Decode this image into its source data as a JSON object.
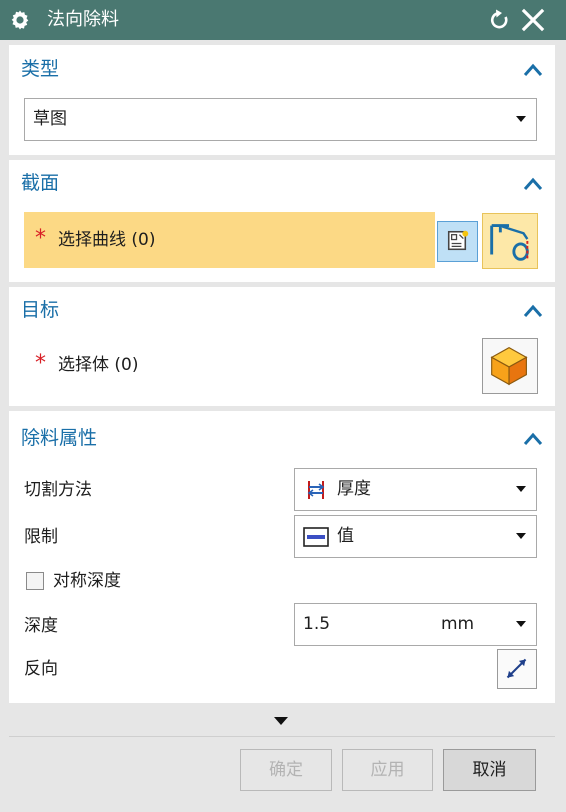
{
  "window": {
    "title": "法向除料"
  },
  "sections": {
    "type": {
      "title": "类型",
      "dropdown_value": "草图"
    },
    "section": {
      "title": "截面",
      "select_label": "选择曲线 (0)",
      "required_mark": "*"
    },
    "target": {
      "title": "目标",
      "select_label": "选择体 (0)",
      "required_mark": "*"
    },
    "cut_properties": {
      "title": "除料属性",
      "cut_method_label": "切割方法",
      "cut_method_value": "厚度",
      "limit_label": "限制",
      "limit_value": "值",
      "symmetric_depth_label": "对称深度",
      "symmetric_depth_checked": false,
      "depth_label": "深度",
      "depth_value": "1.5",
      "depth_unit": "mm",
      "reverse_label": "反向"
    }
  },
  "buttons": {
    "ok": "确定",
    "apply": "应用",
    "cancel": "取消"
  },
  "colors": {
    "titlebar": "#4a7871",
    "section_title": "#1a6fa8",
    "selection_highlight": "#fcd985",
    "required": "#d81f26"
  }
}
